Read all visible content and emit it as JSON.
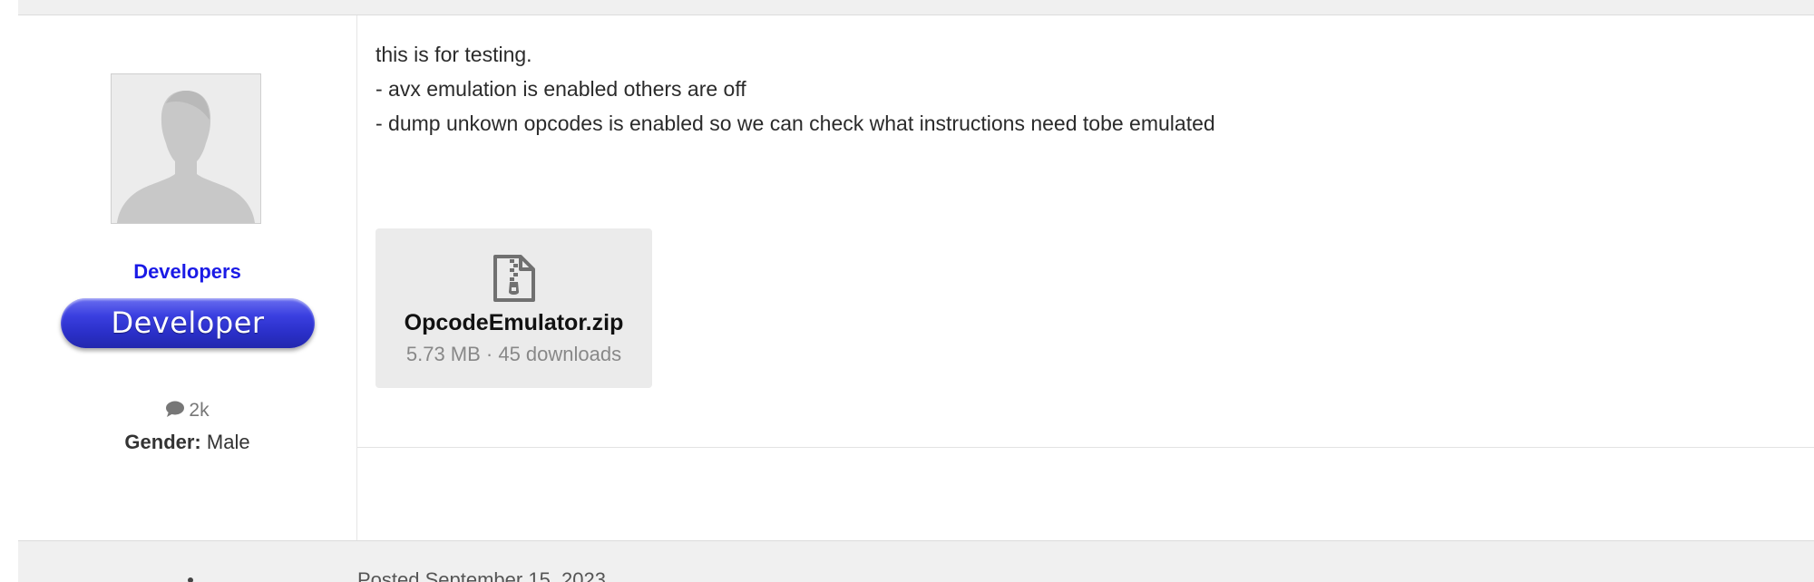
{
  "post": {
    "author": {
      "group": "Developers",
      "badge": "Developer",
      "post_count": "2k",
      "gender_label": "Gender:",
      "gender_value": "Male"
    },
    "body_lines": [
      "this is for testing.",
      "- avx emulation is enabled others are off",
      "- dump unkown opcodes is enabled so we can check what instructions need tobe emulated"
    ],
    "attachment": {
      "icon": "zip-file-icon",
      "filename": "OpcodeEmulator.zip",
      "meta": "5.73 MB · 45 downloads"
    }
  },
  "next_post": {
    "posted": "Posted September 15, 2023"
  },
  "colors": {
    "group_name": "#1a1ae6",
    "badge": "#3a3fe0",
    "strip_background": "#f0f0f0"
  }
}
